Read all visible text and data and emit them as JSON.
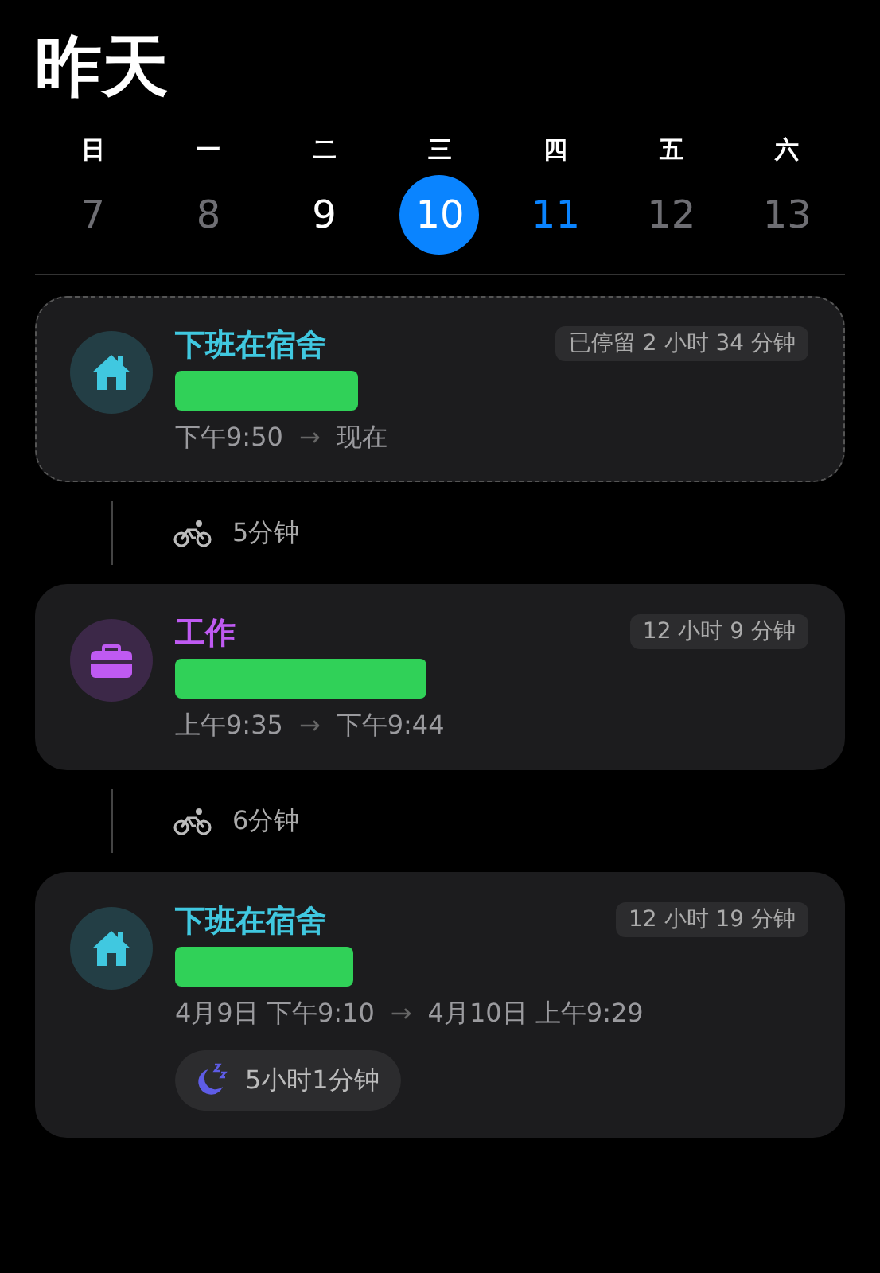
{
  "title": "昨天",
  "week": {
    "weekdays": [
      "日",
      "一",
      "二",
      "三",
      "四",
      "五",
      "六"
    ],
    "days": [
      {
        "label": "7",
        "kind": "muted",
        "selected": false
      },
      {
        "label": "8",
        "kind": "muted",
        "selected": false
      },
      {
        "label": "9",
        "kind": "plain",
        "selected": false
      },
      {
        "label": "10",
        "kind": "plain",
        "selected": true
      },
      {
        "label": "11",
        "kind": "today",
        "selected": false
      },
      {
        "label": "12",
        "kind": "muted",
        "selected": false
      },
      {
        "label": "13",
        "kind": "muted",
        "selected": false
      }
    ]
  },
  "timeline": [
    {
      "kind": "home",
      "color": "#40c8e0",
      "place": "下班在宿舍",
      "duration": "已停留 2 小时 34 分钟",
      "start": "下午9:50",
      "arrow": "→",
      "end": "现在",
      "ongoing": true,
      "redacted": true
    },
    {
      "kind": "ride",
      "duration": "5分钟"
    },
    {
      "kind": "work",
      "color": "#bf5af2",
      "place": "工作",
      "duration": "12 小时 9 分钟",
      "start": "上午9:35",
      "arrow": "→",
      "end": "下午9:44",
      "ongoing": false,
      "redacted": true
    },
    {
      "kind": "ride",
      "duration": "6分钟"
    },
    {
      "kind": "home",
      "color": "#40c8e0",
      "place": "下班在宿舍",
      "duration": "12 小时 19 分钟",
      "start": "4月9日 下午9:10",
      "arrow": "→",
      "end": "4月10日 上午9:29",
      "ongoing": false,
      "redacted": true,
      "sleep": "5小时1分钟"
    }
  ]
}
